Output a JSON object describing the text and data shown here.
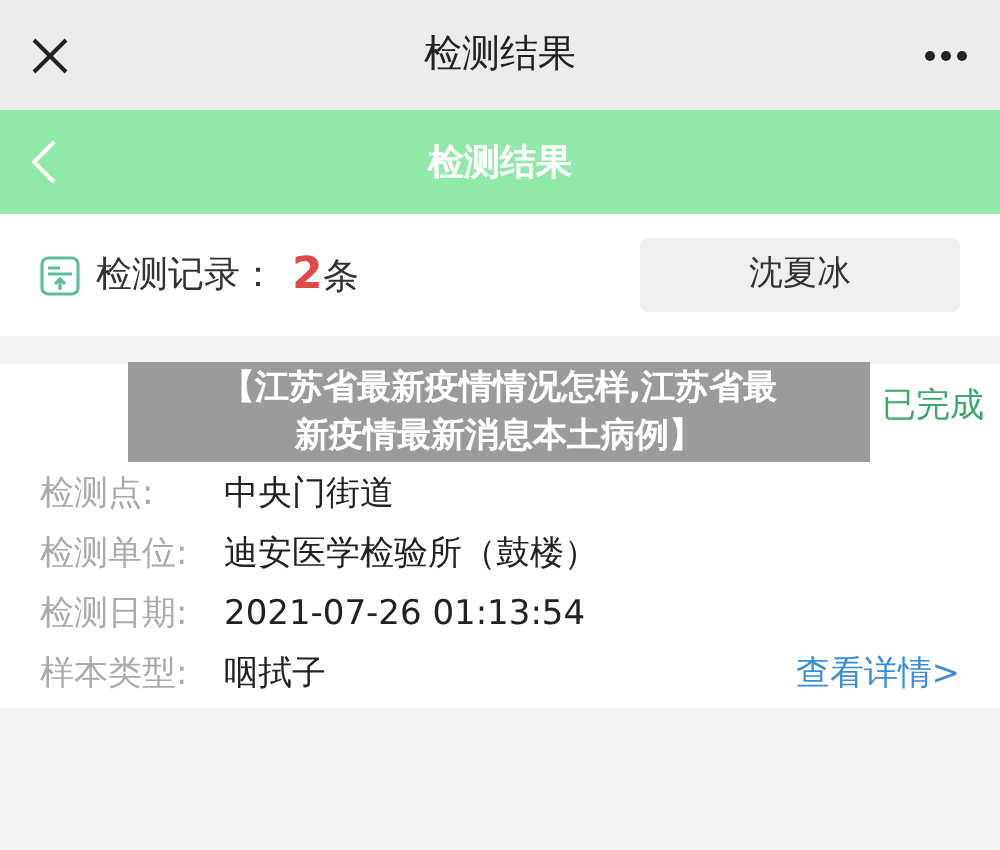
{
  "top_bar": {
    "title": "检测结果"
  },
  "header": {
    "title": "检测结果"
  },
  "records": {
    "label": "检测记录：",
    "count": "2",
    "unit": "条",
    "person": "沈夏冰"
  },
  "result": {
    "status": "已完成",
    "fields": [
      {
        "label": "检测点:",
        "value": "中央门街道"
      },
      {
        "label": "检测单位:",
        "value": "迪安医学检验所（鼓楼）"
      },
      {
        "label": "检测日期:",
        "value": "2021-07-26 01:13:54"
      },
      {
        "label": "样本类型:",
        "value": "咽拭子"
      }
    ],
    "details_link": "查看详情>"
  },
  "banner": {
    "lines": [
      "【江苏省最新疫情情况怎样,江苏省最",
      "新疫情最新消息本土病例】"
    ]
  }
}
